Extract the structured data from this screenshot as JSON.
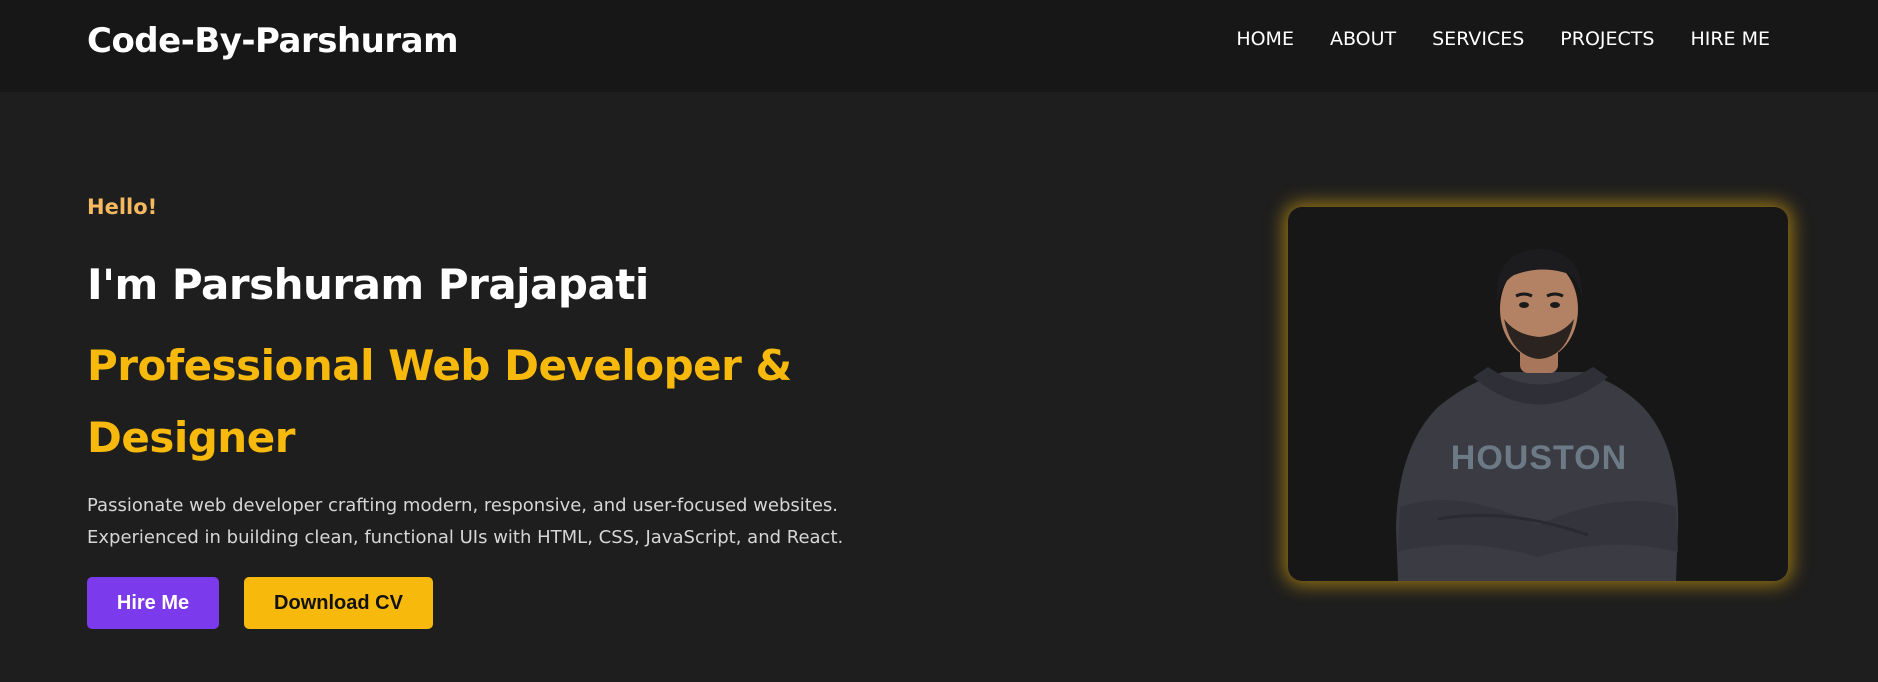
{
  "navbar": {
    "brand": "Code-By-Parshuram",
    "links": [
      "HOME",
      "ABOUT",
      "SERVICES",
      "PROJECTS",
      "HIRE ME"
    ]
  },
  "hero": {
    "greeting": "Hello!",
    "name": "I'm Parshuram Prajapati",
    "role": "Professional Web Developer & Designer",
    "description_line1": "Passionate web developer crafting modern, responsive, and user-focused websites.",
    "description_line2": "Experienced in building clean, functional UIs with HTML, CSS, JavaScript, and React.",
    "buttons": {
      "hire": "Hire Me",
      "cv": "Download CV"
    }
  },
  "portrait": {
    "shirt_text": "HOUSTON"
  },
  "colors": {
    "accent": "#f7b90c",
    "greeting": "#f5b95f",
    "primary_button": "#7c3aed",
    "background": "#1e1e1e",
    "navbar": "#171717"
  }
}
